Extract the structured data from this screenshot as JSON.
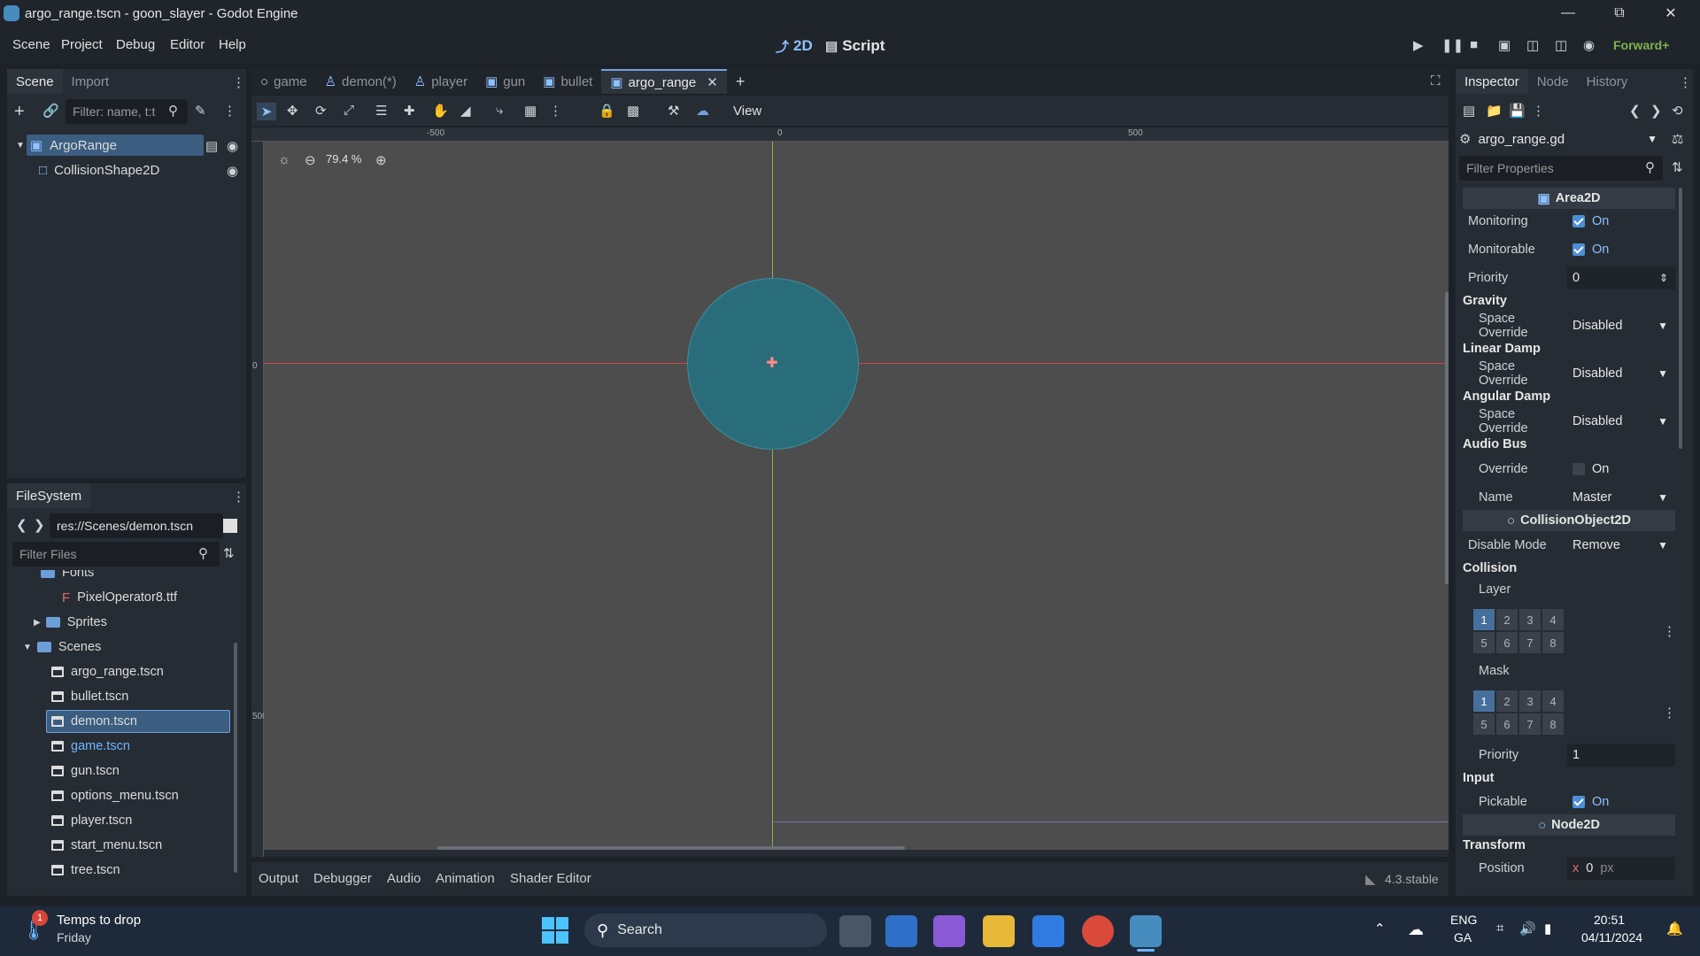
{
  "window": {
    "title": "argo_range.tscn - goon_slayer - Godot Engine"
  },
  "menu": [
    "Scene",
    "Project",
    "Debug",
    "Editor",
    "Help"
  ],
  "modes": {
    "2d": "2D",
    "script": "Script"
  },
  "renderer": "Forward+",
  "scene_dock": {
    "tabs": [
      "Scene",
      "Import"
    ],
    "filter_placeholder": "Filter: name, t:t",
    "nodes": [
      {
        "name": "ArgoRange"
      },
      {
        "name": "CollisionShape2D"
      }
    ]
  },
  "editor_tabs": [
    "game",
    "demon(*)",
    "player",
    "gun",
    "bullet",
    "argo_range"
  ],
  "toolbar": {
    "view": "View"
  },
  "viewport": {
    "zoom": "79.4 %",
    "ruler_labels": [
      "-500",
      "0",
      "500"
    ],
    "vruler_labels": [
      "0",
      "500"
    ]
  },
  "filesystem": {
    "tab": "FileSystem",
    "path": "res://Scenes/demon.tscn",
    "filter_placeholder": "Filter Files",
    "items": [
      {
        "name": "Fonts",
        "type": "folder"
      },
      {
        "name": "PixelOperator8.ttf",
        "type": "font"
      },
      {
        "name": "Sprites",
        "type": "folder"
      },
      {
        "name": "Scenes",
        "type": "folder"
      },
      {
        "name": "argo_range.tscn",
        "type": "scene"
      },
      {
        "name": "bullet.tscn",
        "type": "scene"
      },
      {
        "name": "demon.tscn",
        "type": "scene"
      },
      {
        "name": "game.tscn",
        "type": "scene"
      },
      {
        "name": "gun.tscn",
        "type": "scene"
      },
      {
        "name": "options_menu.tscn",
        "type": "scene"
      },
      {
        "name": "player.tscn",
        "type": "scene"
      },
      {
        "name": "start_menu.tscn",
        "type": "scene"
      },
      {
        "name": "tree.tscn",
        "type": "scene"
      }
    ]
  },
  "bottom_tabs": [
    "Output",
    "Debugger",
    "Audio",
    "Animation",
    "Shader Editor"
  ],
  "version": "4.3.stable",
  "inspector": {
    "tabs": [
      "Inspector",
      "Node",
      "History"
    ],
    "script_file": "argo_range.gd",
    "filter_placeholder": "Filter Properties",
    "area2d": "Area2D",
    "monitoring": "Monitoring",
    "monitorable": "Monitorable",
    "on": "On",
    "priority": "Priority",
    "priority_value": "0",
    "gravity": "Gravity",
    "space_override": "Space Override",
    "disabled": "Disabled",
    "linear_damp": "Linear Damp",
    "angular_damp": "Angular Damp",
    "audio_bus": "Audio Bus",
    "override": "Override",
    "name": "Name",
    "master": "Master",
    "collision_object": "CollisionObject2D",
    "disable_mode": "Disable Mode",
    "remove": "Remove",
    "collision": "Collision",
    "layer": "Layer",
    "mask": "Mask",
    "layer_bits": [
      "1",
      "2",
      "3",
      "4",
      "5",
      "6",
      "7",
      "8"
    ],
    "priority2_value": "1",
    "input": "Input",
    "pickable": "Pickable",
    "node2d": "Node2D",
    "transform": "Transform",
    "position": "Position",
    "pos_x_label": "x",
    "pos_x": "0",
    "px": "px"
  },
  "taskbar": {
    "weather_title": "Temps to drop",
    "weather_sub": "Friday",
    "weather_badge": "1",
    "search": "Search",
    "lang": "ENG",
    "lang2": "GA",
    "time": "20:51",
    "date": "04/11/2024"
  },
  "colors": {
    "accent": "#478cbf",
    "circle": "#2a6d7a",
    "viewport": "#4d4d4d"
  }
}
